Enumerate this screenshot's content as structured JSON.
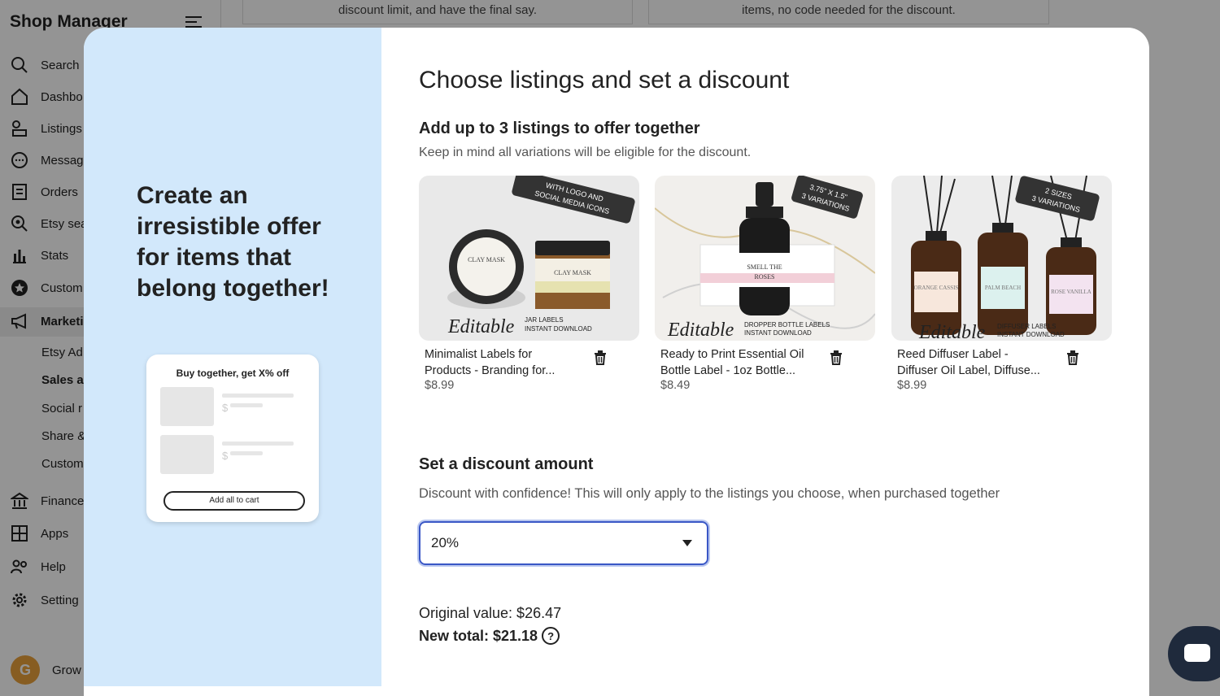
{
  "app": {
    "brand": "Shop Manager",
    "top_cards": [
      {
        "text": "discount limit, and have the final say."
      },
      {
        "text": "items, no code needed for the discount."
      }
    ],
    "nav": [
      {
        "label": "Search",
        "icon": "search-icon"
      },
      {
        "label": "Dashbo",
        "icon": "home-icon"
      },
      {
        "label": "Listings",
        "icon": "listings-icon"
      },
      {
        "label": "Messag",
        "icon": "messages-icon"
      },
      {
        "label": "Orders",
        "icon": "orders-icon"
      },
      {
        "label": "Etsy sea",
        "icon": "etsy-search-icon"
      },
      {
        "label": "Stats",
        "icon": "stats-icon"
      },
      {
        "label": "Custom",
        "icon": "customers-icon"
      },
      {
        "label": "Marketi",
        "icon": "megaphone-icon"
      }
    ],
    "marketing_sub": [
      {
        "label": "Etsy Ad"
      },
      {
        "label": "Sales ar"
      },
      {
        "label": "Social r"
      },
      {
        "label": "Share &"
      },
      {
        "label": "Custom"
      }
    ],
    "nav_bottom": [
      {
        "label": "Finance",
        "icon": "bank-icon"
      },
      {
        "label": "Apps",
        "icon": "apps-icon"
      },
      {
        "label": "Help",
        "icon": "help-people-icon"
      },
      {
        "label": "Setting",
        "icon": "gear-icon"
      }
    ],
    "grow_label": "Grow",
    "avatar_letter": "G"
  },
  "modal": {
    "promo_text": "Create an irresistible offer for items that belong together!",
    "mock": {
      "title": "Buy together, get X% off",
      "dollar": "$",
      "button": "Add all to cart"
    },
    "heading": "Choose listings and set a discount",
    "listings_heading": "Add up to 3 listings to offer together",
    "listings_sub": "Keep in mind all variations will be eligible for the discount.",
    "listings": [
      {
        "title": "Minimalist Labels for Products - Branding for...",
        "price": "$8.99",
        "badge": [
          "WITH LOGO AND",
          "SOCIAL MEDIA ICONS"
        ],
        "script": "Editable",
        "caption": [
          "JAR LABELS",
          "INSTANT DOWNLOAD"
        ],
        "labels": [
          "CLAY MASK",
          "CLAY MASK"
        ]
      },
      {
        "title": "Ready to Print Essential Oil Bottle Label - 1oz Bottle...",
        "price": "$8.49",
        "badge": [
          "3.75\" X 1.5\"",
          "3 VARIATIONS"
        ],
        "script": "Editable",
        "caption": [
          "DROPPER BOTTLE LABELS",
          "INSTANT DOWNLOAD"
        ],
        "labels": [
          "SMELL THE",
          "ROSES"
        ]
      },
      {
        "title": "Reed Diffuser Label - Diffuser Oil Label, Diffuse...",
        "price": "$8.99",
        "badge": [
          "2 SIZES",
          "3 VARIATIONS"
        ],
        "script": "Editable",
        "caption": [
          "DIFFUSER LABELS",
          "INSTANT DOWNLOAD"
        ],
        "labels": [
          "ORANGE CASSIS",
          "PALM BEACH",
          "ROSE VANILLA"
        ]
      }
    ],
    "discount_heading": "Set a discount amount",
    "discount_sub": "Discount with confidence! This will only apply to the listings you choose, when purchased together",
    "discount_value": "20%",
    "original_value": "Original value: $26.47",
    "new_total": "New total: $21.18",
    "help_glyph": "?"
  },
  "colors": {
    "left_panel": "#d2e8fb",
    "select_border": "#3a57c6",
    "chat_button": "#1f2a3c"
  }
}
